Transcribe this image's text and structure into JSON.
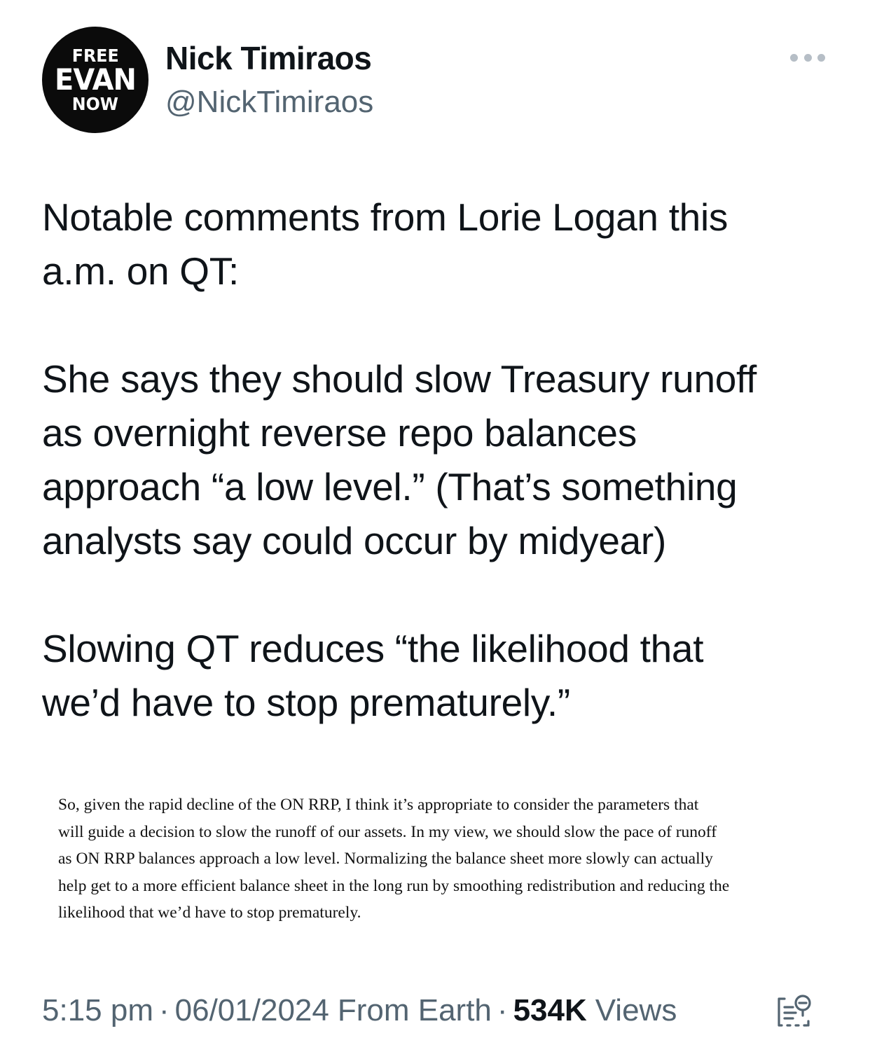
{
  "author": {
    "avatar_lines": [
      "FREE",
      "EVAN",
      "NOW"
    ],
    "display_name": "Nick Timiraos",
    "handle": "@NickTimiraos"
  },
  "tweet": {
    "paragraphs": [
      [
        "Notable comments from Lorie Logan this",
        "a.m. on QT:"
      ],
      [
        "She says they should slow Treasury runoff",
        "as overnight reverse repo balances",
        "approach “a low level.” (That’s something",
        "analysts say could occur by midyear)"
      ],
      [
        "Slowing QT reduces “the likelihood that",
        "we’d have to stop prematurely.”"
      ]
    ]
  },
  "quote_image": {
    "lines": [
      "So, given the rapid decline of the ON RRP, I think it’s appropriate to consider the parameters that",
      "will guide a decision to slow the runoff of our assets. In my view, we should slow the pace of runoff",
      "as ON RRP balances approach a low level. Normalizing the balance sheet more slowly can actually",
      "help get to a more efficient balance sheet in the long run by smoothing redistribution and reducing the",
      "likelihood that we’d have to stop prematurely."
    ]
  },
  "meta": {
    "time": "5:15 pm",
    "separator": "·",
    "date": "06/01/2024",
    "location": "From Earth",
    "views_count": "534K",
    "views_label": "Views"
  },
  "icons": {
    "more": "more-options-icon",
    "analytics": "analytics-icon"
  },
  "colors": {
    "text_primary": "#0f1419",
    "text_secondary": "#536471",
    "avatar_bg": "#0b0b0b"
  }
}
